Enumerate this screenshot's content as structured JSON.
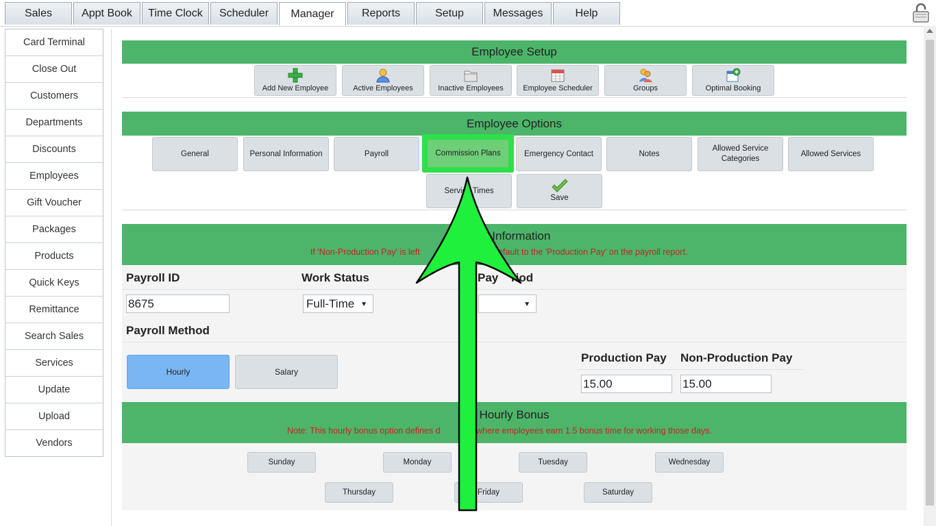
{
  "top_tabs": [
    "Sales",
    "Appt Book",
    "Time Clock",
    "Scheduler",
    "Manager",
    "Reports",
    "Setup",
    "Messages",
    "Help"
  ],
  "active_tab": "Manager",
  "sidebar": [
    "Card Terminal",
    "Close Out",
    "Customers",
    "Departments",
    "Discounts",
    "Employees",
    "Gift Voucher",
    "Packages",
    "Products",
    "Quick Keys",
    "Remittance",
    "Search Sales",
    "Services",
    "Update",
    "Upload",
    "Vendors"
  ],
  "employee_setup": {
    "title": "Employee Setup",
    "buttons": [
      "Add New Employee",
      "Active Employees",
      "Inactive Employees",
      "Employee Scheduler",
      "Groups",
      "Optimal Booking"
    ]
  },
  "employee_options": {
    "title": "Employee Options",
    "buttons": [
      "General",
      "Personal Information",
      "Payroll",
      "Commission Plans",
      "Emergency Contact",
      "Notes",
      "Allowed Service Categories",
      "Allowed Services",
      "Service Times",
      "Save"
    ]
  },
  "payroll": {
    "title_fragment": "ll Information",
    "note_left": "If 'Non-Production Pay' is left",
    "note_right": "default to the 'Production Pay' on the payroll report.",
    "payroll_id_label": "Payroll ID",
    "payroll_id": "8675",
    "work_status_label": "Work Status",
    "work_status": "Full-Time",
    "pay_period_label_fragment": "Pay",
    "pay_period_label_right": "riod",
    "pay_period": "",
    "method_label": "Payroll Method",
    "methods": [
      "Hourly",
      "Salary"
    ],
    "selected_method": "Hourly",
    "production_pay_label": "Production Pay",
    "production_pay": "15.00",
    "non_production_pay_label": "Non-Production Pay",
    "non_production_pay": "15.00"
  },
  "hourly_bonus": {
    "title": "Hourly Bonus",
    "note_left": "Note: This hourly bonus option defines d",
    "note_right": "where employees earn 1.5 bonus time for working those days.",
    "days": [
      "Sunday",
      "Monday",
      "Tuesday",
      "Wednesday",
      "Thursday",
      "Friday",
      "Saturday"
    ]
  },
  "colors": {
    "section_green": "#4cb56a",
    "highlight_green": "#2ee04a",
    "arrow_green": "#1ff03c",
    "selected_blue": "#7ab6f4",
    "note_red": "#c8231f"
  }
}
